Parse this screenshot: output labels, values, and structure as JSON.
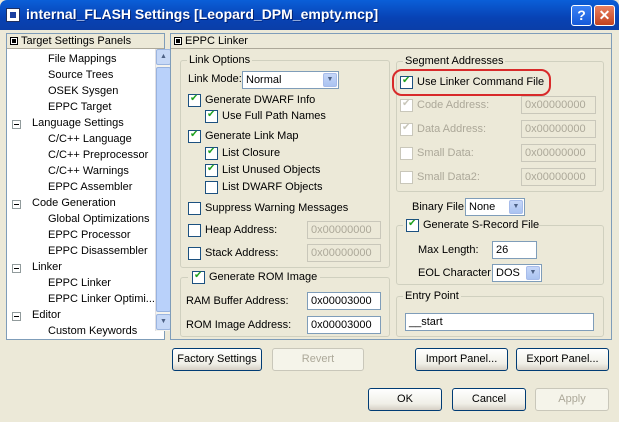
{
  "window": {
    "title": "internal_FLASH Settings [Leopard_DPM_empty.mcp]",
    "help": "?",
    "close": "✕"
  },
  "tree": {
    "header": "Target Settings Panels",
    "items": [
      "File Mappings",
      "Source Trees",
      "OSEK Sysgen",
      "EPPC Target",
      "Language Settings",
      "C/C++ Language",
      "C/C++ Preprocessor",
      "C/C++ Warnings",
      "EPPC Assembler",
      "Code Generation",
      "Global Optimizations",
      "EPPC Processor",
      "EPPC Disassembler",
      "Linker",
      "EPPC Linker",
      "EPPC Linker Optimi...",
      "Editor",
      "Custom Keywords"
    ]
  },
  "panel": {
    "header": "EPPC Linker"
  },
  "link_options": {
    "title": "Link Options",
    "link_mode_label": "Link Mode:",
    "link_mode_value": "Normal",
    "generate_dwarf": "Generate DWARF Info",
    "use_full_path": "Use Full Path Names",
    "generate_link_map": "Generate Link Map",
    "list_closure": "List Closure",
    "list_unused": "List Unused Objects",
    "list_dwarf": "List DWARF Objects",
    "suppress_warnings": "Suppress Warning Messages",
    "heap_address": "Heap Address:",
    "heap_value": "0x00000000",
    "stack_address": "Stack Address:",
    "stack_value": "0x00000000"
  },
  "rom_image": {
    "title": "Generate ROM Image",
    "ram_buffer_label": "RAM Buffer Address:",
    "ram_buffer_value": "0x00003000",
    "rom_image_label": "ROM Image Address:",
    "rom_image_value": "0x00003000"
  },
  "segment": {
    "title": "Segment Addresses",
    "use_linker_cmd": "Use Linker Command File",
    "code_address": "Code Address:",
    "code_value": "0x00000000",
    "data_address": "Data Address:",
    "data_value": "0x00000000",
    "small_data": "Small Data:",
    "small_data_value": "0x00000000",
    "small_data2": "Small Data2:",
    "small_data2_value": "0x00000000"
  },
  "binary_file": {
    "label": "Binary File:",
    "value": "None"
  },
  "srecord": {
    "title": "Generate S-Record File",
    "max_length_label": "Max Length:",
    "max_length_value": "26",
    "eol_label": "EOL Character:",
    "eol_value": "DOS"
  },
  "entry_point": {
    "title": "Entry Point",
    "value": "__start"
  },
  "buttons": {
    "factory": "Factory Settings",
    "revert": "Revert",
    "import": "Import Panel...",
    "export": "Export Panel...",
    "ok": "OK",
    "cancel": "Cancel",
    "apply": "Apply"
  }
}
